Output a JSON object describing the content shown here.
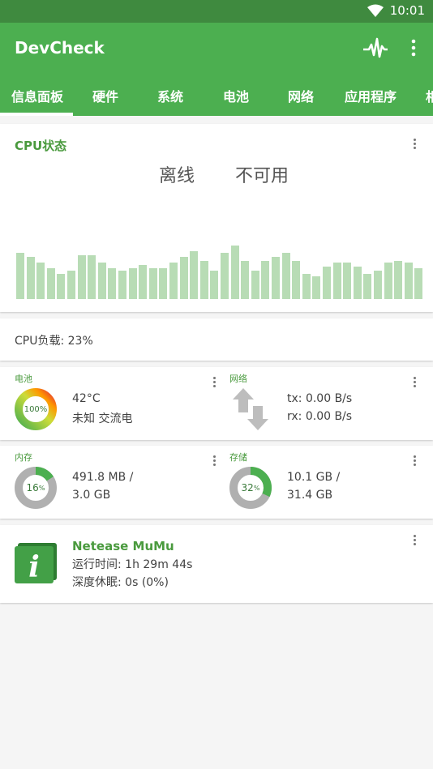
{
  "status_bar": {
    "time": "10:01",
    "icons": [
      "wifi-icon"
    ]
  },
  "app_bar": {
    "title": "DevCheck",
    "icons": [
      "pulse-icon",
      "more-vert-icon"
    ]
  },
  "tabs": [
    {
      "label": "信息面板",
      "selected": true
    },
    {
      "label": "硬件"
    },
    {
      "label": "系统"
    },
    {
      "label": "电池"
    },
    {
      "label": "网络"
    },
    {
      "label": "应用程序"
    },
    {
      "label": "相"
    }
  ],
  "cpu_status": {
    "title": "CPU状态",
    "state_1": "离线",
    "state_2": "不可用",
    "history_levels_percent": [
      48,
      44,
      38,
      32,
      26,
      30,
      46,
      46,
      38,
      32,
      30,
      32,
      36,
      32,
      32,
      38,
      44,
      50,
      40,
      30,
      48,
      56,
      40,
      30,
      40,
      44,
      48,
      40,
      26,
      24,
      34,
      38,
      38,
      34,
      26,
      30,
      38,
      40,
      38,
      32
    ],
    "bar_color": "#b8dcb5"
  },
  "cpu_load": {
    "text": "CPU负载: 23%"
  },
  "battery": {
    "label": "电池",
    "percent_text": "100%",
    "level_percent": 100,
    "temp": "42°C",
    "status": "未知 交流电"
  },
  "network": {
    "label": "网络",
    "tx": "tx: 0.00 B/s",
    "rx": "rx: 0.00 B/s"
  },
  "memory": {
    "label": "内存",
    "gauge_value": "16",
    "gauge_unit": "%",
    "percent": 16,
    "line1": "491.8 MB /",
    "line2": "3.0 GB"
  },
  "storage": {
    "label": "存储",
    "gauge_value": "32",
    "gauge_unit": "%",
    "percent": 32,
    "line1": "10.1 GB /",
    "line2": "31.4 GB"
  },
  "device": {
    "name": "Netease MuMu",
    "uptime": "运行时间: 1h 29m 44s",
    "deep_sleep": "深度休眠: 0s (0%)",
    "icon": "info-icon"
  },
  "colors": {
    "accent": "#4caf50",
    "status_bar": "#3f8a3f",
    "gauge_green": "#4caf50",
    "gauge_gray": "#b0b0b0"
  }
}
